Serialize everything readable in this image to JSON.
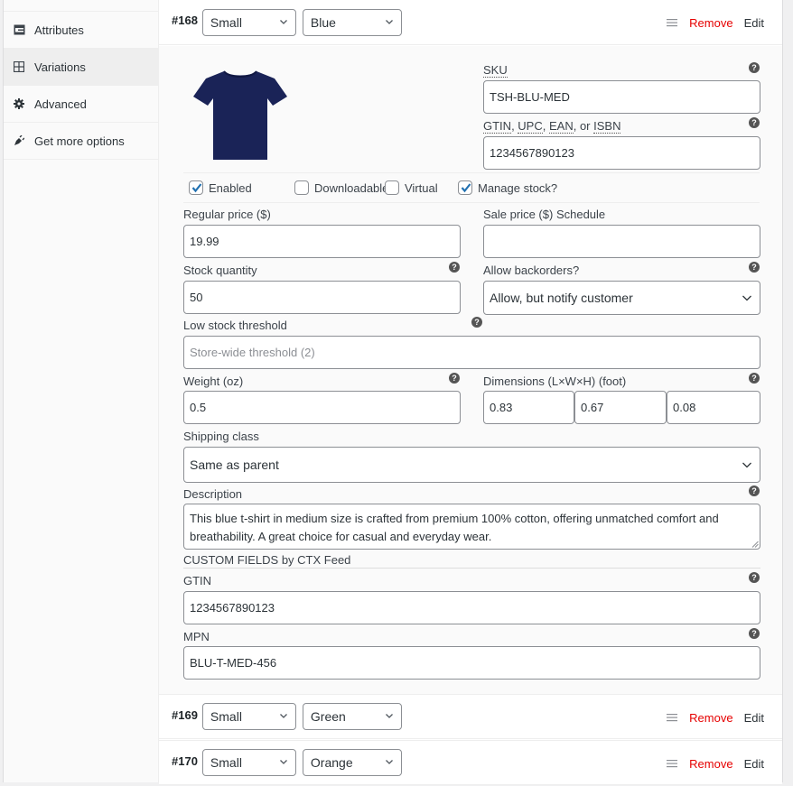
{
  "sidebar": {
    "items": [
      {
        "label": "Attributes",
        "icon": "attributes-icon",
        "active": false
      },
      {
        "label": "Variations",
        "icon": "variations-grid-icon",
        "active": true
      },
      {
        "label": "Advanced",
        "icon": "gear-icon",
        "active": false
      },
      {
        "label": "Get more options",
        "icon": "plugin-icon",
        "active": false
      }
    ]
  },
  "variations": [
    {
      "id": "#168",
      "size": "Small",
      "color": "Blue",
      "remove": "Remove",
      "edit": "Edit"
    },
    {
      "id": "#169",
      "size": "Small",
      "color": "Green",
      "remove": "Remove",
      "edit": "Edit"
    },
    {
      "id": "#170",
      "size": "Small",
      "color": "Orange",
      "remove": "Remove",
      "edit": "Edit"
    }
  ],
  "detail": {
    "image_alt": "Navy blue t-shirt",
    "sku": {
      "label": "SKU",
      "value": "TSH-BLU-MED"
    },
    "gtin_label_parts": [
      "GTIN",
      ", ",
      "UPC",
      ", ",
      "EAN",
      ", or ",
      "ISBN"
    ],
    "gtin_value": "1234567890123",
    "checkboxes": [
      {
        "label": "Enabled",
        "checked": true
      },
      {
        "label": "Downloadable",
        "checked": false
      },
      {
        "label": "Virtual",
        "checked": false
      },
      {
        "label": "Manage stock?",
        "checked": true
      }
    ],
    "regular_price": {
      "label": "Regular price ($)",
      "value": "19.99"
    },
    "sale_price": {
      "label": "Sale price ($)",
      "schedule": "Schedule",
      "value": ""
    },
    "stock_quantity": {
      "label": "Stock quantity",
      "value": "50"
    },
    "backorders": {
      "label": "Allow backorders?",
      "value": "Allow, but notify customer"
    },
    "low_stock": {
      "label": "Low stock threshold",
      "placeholder": "Store-wide threshold (2)"
    },
    "weight": {
      "label": "Weight (oz)",
      "value": "0.5"
    },
    "dimensions": {
      "label": "Dimensions (L×W×H) (foot)",
      "length": "0.83",
      "width": "0.67",
      "height": "0.08"
    },
    "shipping_class": {
      "label": "Shipping class",
      "value": "Same as parent"
    },
    "description": {
      "label": "Description",
      "value": "This blue t-shirt in medium size is crafted from premium 100% cotton, offering unmatched comfort and breathability. A great choice for casual and everyday wear."
    },
    "custom_fields_heading": "CUSTOM FIELDS by CTX Feed",
    "custom_gtin": {
      "label": "GTIN",
      "value": "1234567890123"
    },
    "custom_mpn": {
      "label": "MPN",
      "value": "BLU-T-MED-456"
    },
    "help_glyph": "?"
  },
  "colors": {
    "remove": "#e60000",
    "checkbox_accent": "#2271b1",
    "tshirt": "#1a2357"
  }
}
